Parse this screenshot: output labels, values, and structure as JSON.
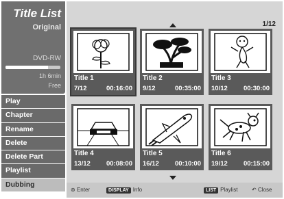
{
  "info": {
    "title": "Title List",
    "subtitle": "Original",
    "disc": "DVD-RW",
    "remaining_fraction": 0.78,
    "time": "1h 6min",
    "free": "Free"
  },
  "menu": [
    {
      "label": "Play"
    },
    {
      "label": "Chapter"
    },
    {
      "label": "Rename"
    },
    {
      "label": "Delete"
    },
    {
      "label": "Delete Part"
    },
    {
      "label": "Playlist"
    },
    {
      "label": "Dubbing"
    }
  ],
  "pager": "1/12",
  "titles": [
    {
      "name": "Title 1",
      "count": "7/12",
      "duration": "00:16:00",
      "icon": "rose-icon"
    },
    {
      "name": "Title 2",
      "count": "9/12",
      "duration": "00:35:00",
      "icon": "bonsai-icon"
    },
    {
      "name": "Title 3",
      "count": "10/12",
      "duration": "00:30:00",
      "icon": "cartoon-monkey-icon"
    },
    {
      "name": "Title 4",
      "count": "13/12",
      "duration": "00:08:00",
      "icon": "car-icon"
    },
    {
      "name": "Title 5",
      "count": "16/12",
      "duration": "00:10:00",
      "icon": "space-shuttle-icon"
    },
    {
      "name": "Title 6",
      "count": "19/12",
      "duration": "00:15:00",
      "icon": "running-dog-icon"
    }
  ],
  "footer": {
    "enter": "Enter",
    "display_btn": "DISPLAY",
    "info": "Info",
    "list_btn": "LIST",
    "playlist": "Playlist",
    "close": "Close"
  }
}
